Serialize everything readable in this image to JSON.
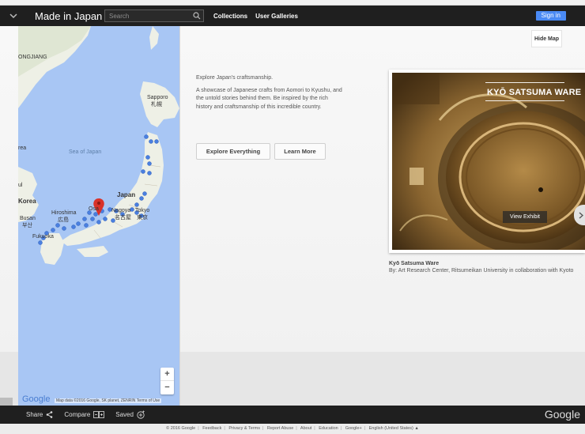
{
  "header": {
    "title": "Made in Japan",
    "search_placeholder": "Search",
    "nav": [
      "Collections",
      "User Galleries"
    ],
    "sign_in": "Sign in"
  },
  "map": {
    "labels": {
      "heilongjiang": "ONGJIANG",
      "sapporo": "Sapporo",
      "sapporo_jp": "札幌",
      "sea_of_japan": "Sea of Japan",
      "rea": "rea",
      "ul": "ul",
      "korea": "Korea",
      "busan": "Busan",
      "busan_kr": "부산",
      "hiroshima": "Hiroshima",
      "hiroshima_jp": "広島",
      "japan": "Japan",
      "osaka": "Osa",
      "nagoya": "Nagoya",
      "nagoya_jp": "名古屋",
      "tokyo": "Tokyo",
      "tokyo_jp": "東京",
      "fukuoka": "Fukuoka"
    },
    "zoom_in": "+",
    "zoom_out": "−",
    "logo": "Google",
    "attribution": "Map data ©2016 Google, SK planet, ZENRIN   Terms of Use"
  },
  "hide_map": "Hide Map",
  "intro": {
    "line1": "Explore Japan's craftsmanship.",
    "line2": "A showcase of Japanese crafts from Aomori to Kyushu, and the untold stories behind them. Be inspired by the rich history and craftsmanship of this incredible country."
  },
  "buttons": {
    "explore": "Explore Everything",
    "learn": "Learn More"
  },
  "exhibit": {
    "title": "KYŌ SATSUMA WARE",
    "view": "View Exhibit",
    "caption_name": "Kyō Satsuma Ware",
    "caption_by": "By: Art Research Center, Ritsumeikan University in collaboration with Kyoto"
  },
  "bottom_bar": {
    "share": "Share",
    "compare": "Compare",
    "saved": "Saved",
    "logo": "Google"
  },
  "footer": [
    "© 2016 Google",
    "Feedback",
    "Privacy & Terms",
    "Report Abuse",
    "About",
    "Education",
    "Google+",
    "English (United States) ▲"
  ],
  "colors": {
    "header_bg": "#1f1f1f",
    "accent": "#4a8af4",
    "water": "#a8c6f4",
    "land": "#f0ece2",
    "marker": "#4a7fe0"
  }
}
